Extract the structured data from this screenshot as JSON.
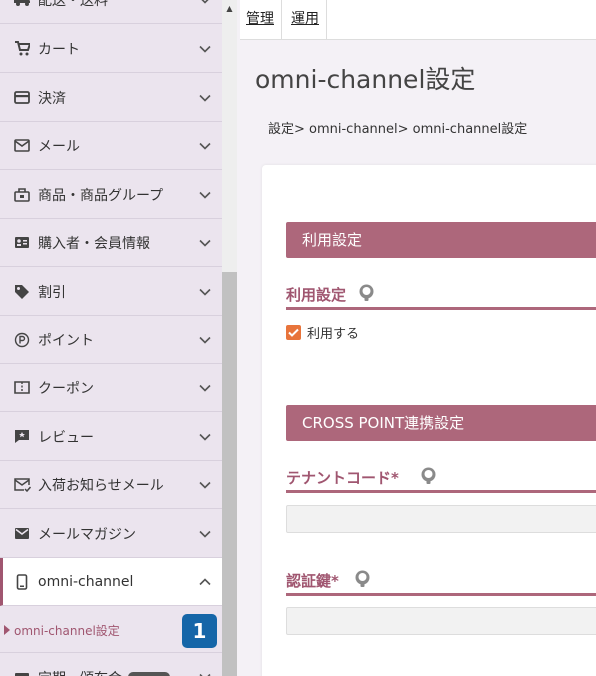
{
  "sidebar": {
    "items": [
      {
        "label": "配送・送料",
        "icon": "truck-icon"
      },
      {
        "label": "カート",
        "icon": "cart-icon"
      },
      {
        "label": "決済",
        "icon": "credit-card-icon"
      },
      {
        "label": "メール",
        "icon": "envelope-icon"
      },
      {
        "label": "商品・商品グループ",
        "icon": "product-icon"
      },
      {
        "label": "購入者・会員情報",
        "icon": "id-card-icon"
      },
      {
        "label": "割引",
        "icon": "tag-icon"
      },
      {
        "label": "ポイント",
        "icon": "point-icon"
      },
      {
        "label": "クーポン",
        "icon": "coupon-icon"
      },
      {
        "label": "レビュー",
        "icon": "review-icon"
      },
      {
        "label": "入荷お知らせメール",
        "icon": "notice-mail-icon"
      },
      {
        "label": "メールマガジン",
        "icon": "newsletter-icon"
      },
      {
        "label": "omni-channel",
        "icon": "mobile-icon"
      }
    ],
    "subitem": {
      "label": "omni-channel設定"
    },
    "partial_item": {
      "label": "定期・頒布会"
    },
    "badge": "1"
  },
  "tabs": [
    {
      "label": "管理"
    },
    {
      "label": "運用"
    }
  ],
  "page": {
    "title": "omni-channel設定",
    "breadcrumb": "設定> omni-channel> omni-channel設定"
  },
  "sections": [
    {
      "title": "利用設定"
    },
    {
      "title": "CROSS POINT連携設定"
    }
  ],
  "fields": {
    "usage": {
      "label": "利用設定",
      "checkbox_label": "利用する",
      "checked": true
    },
    "tenant_code": {
      "label": "テナントコード*",
      "value": ""
    },
    "auth_key": {
      "label": "認証鍵*",
      "value": ""
    }
  },
  "colors": {
    "accent": "#ad677b",
    "checkbox": "#e8743b",
    "badge": "#1566a8"
  }
}
